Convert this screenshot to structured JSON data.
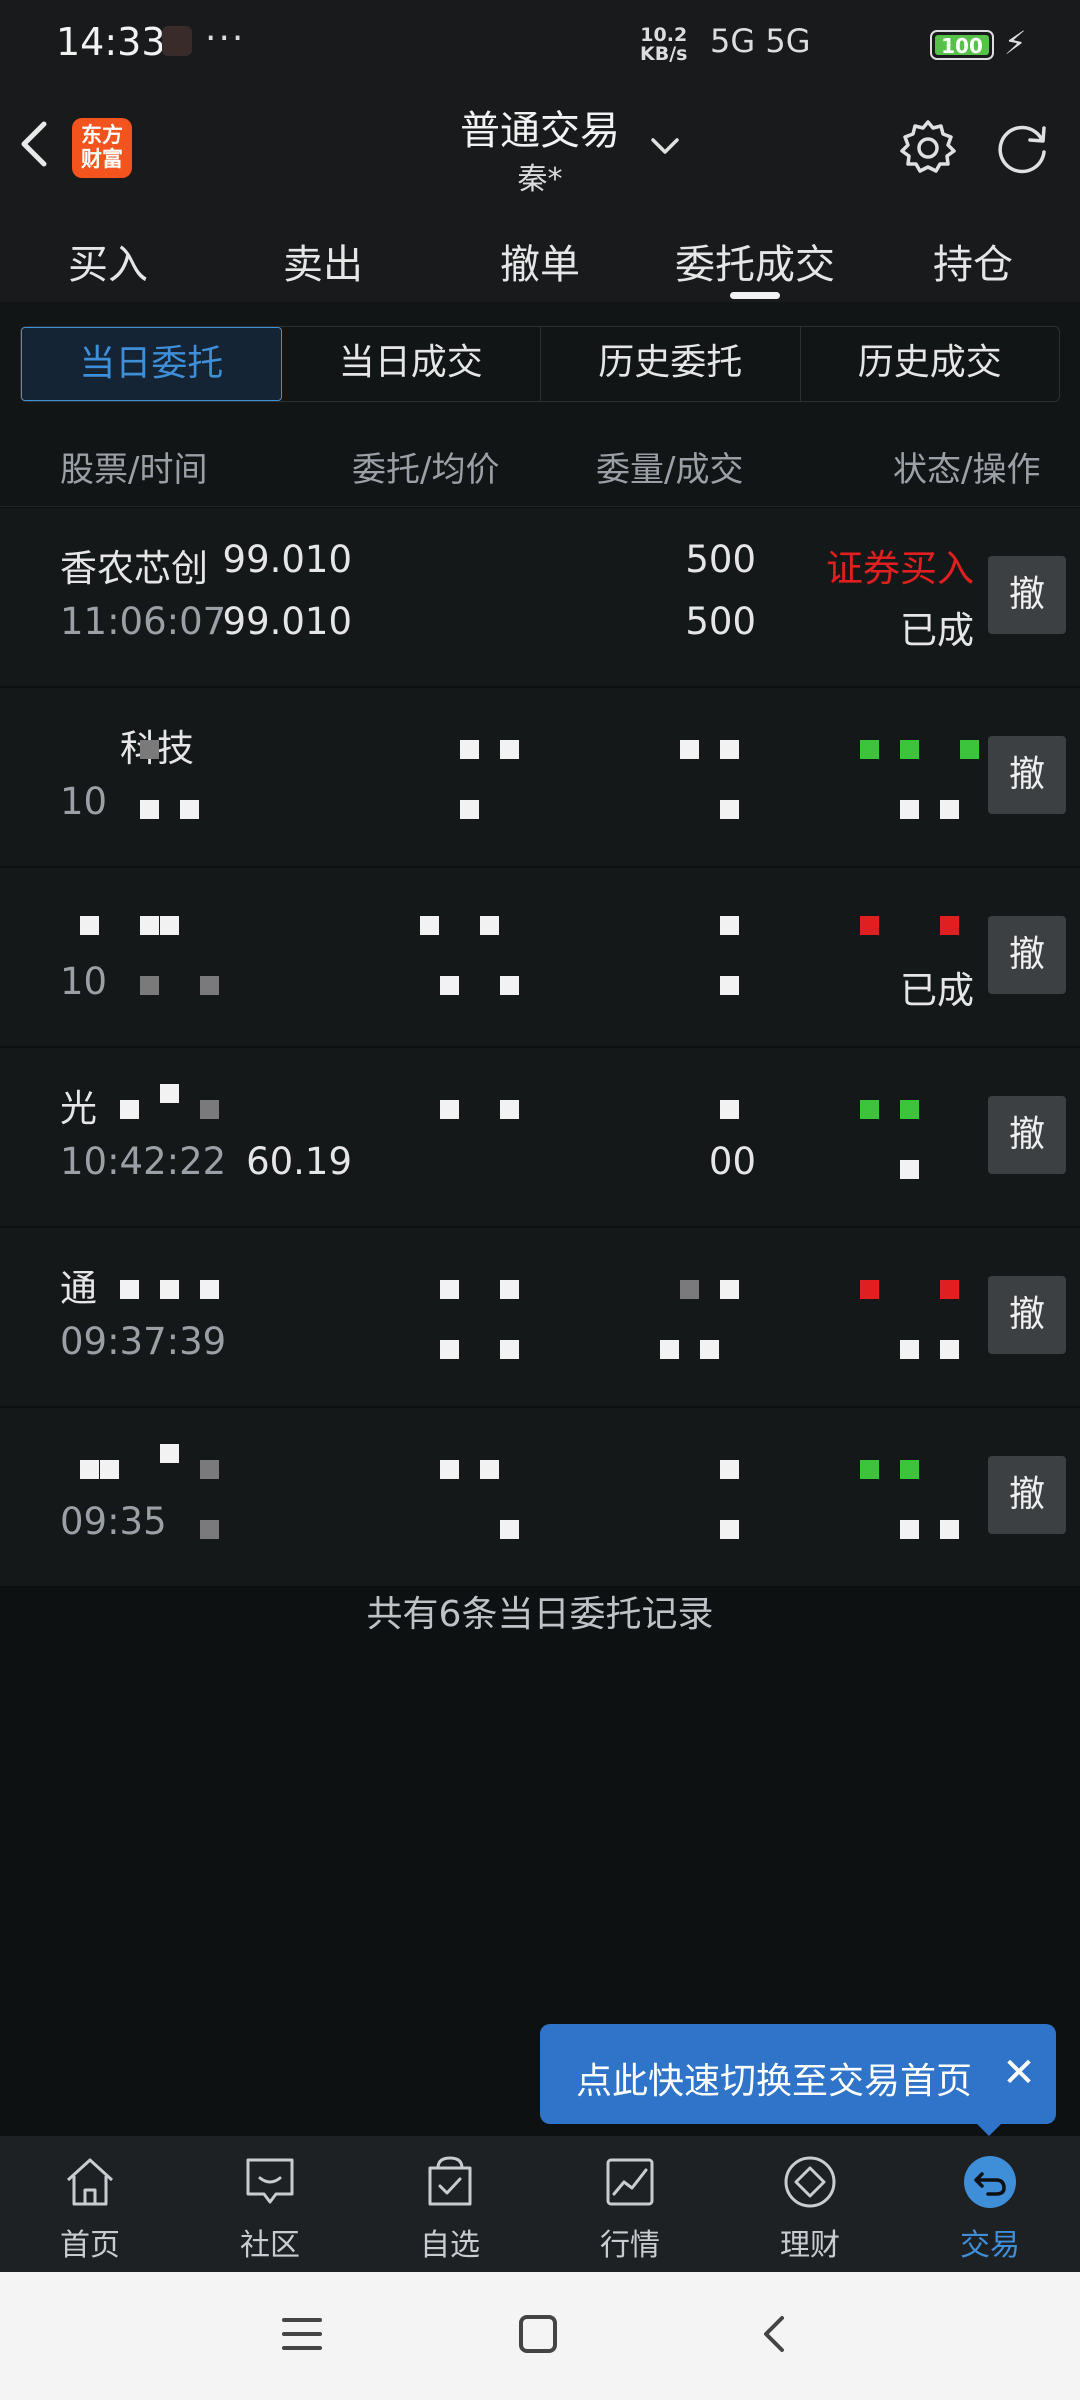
{
  "status_bar": {
    "time": "14:33",
    "dots": "···",
    "net_speed_top": "10.2",
    "net_speed_bottom": "KB/s",
    "signal_icons": "5G 5G",
    "battery": "100"
  },
  "header": {
    "logo_text": "东方财富",
    "title": "普通交易",
    "subtitle": "秦*"
  },
  "tabs": [
    "买入",
    "卖出",
    "撤单",
    "委托成交",
    "持仓"
  ],
  "active_tab": "委托成交",
  "segments": [
    "当日委托",
    "当日成交",
    "历史委托",
    "历史成交"
  ],
  "active_segment": "当日委托",
  "columns": {
    "stock_time": "股票/时间",
    "price_avg": "委托/均价",
    "qty_deal": "委量/成交",
    "status_op": "状态/操作"
  },
  "rows": [
    {
      "name": "香农芯创",
      "time": "11:06:07",
      "price": "99.010",
      "avg": "99.010",
      "qty": "500",
      "deal": "500",
      "status": "证券买入",
      "op": "已成",
      "cancel": "撤"
    },
    {
      "name": "科技",
      "time": "10",
      "price": "",
      "avg": "",
      "qty": "",
      "deal": "",
      "status": "",
      "op": "",
      "cancel": "撤"
    },
    {
      "name": "",
      "time": "10",
      "price": "",
      "avg": "",
      "qty": "",
      "deal": "",
      "status": "",
      "op": "已成",
      "cancel": "撤"
    },
    {
      "name": "光",
      "time": "10:42:22",
      "price": "",
      "avg": "60.19",
      "qty": "",
      "deal": "00",
      "status": "",
      "op": "",
      "cancel": "撤"
    },
    {
      "name": "通",
      "time": "09:37:39",
      "price": "",
      "avg": "",
      "qty": "",
      "deal": "",
      "status": "",
      "op": "",
      "cancel": "撤"
    },
    {
      "name": "",
      "time": "09:35",
      "price": "",
      "avg": "",
      "qty": "",
      "deal": "",
      "status": "",
      "op": "",
      "cancel": "撤"
    }
  ],
  "records_text": "共有6条当日委托记录",
  "tooltip": {
    "text": "点此快速切换至交易首页",
    "close": "✕"
  },
  "bottom_nav": [
    "首页",
    "社区",
    "自选",
    "行情",
    "理财",
    "交易"
  ],
  "active_nav": "交易",
  "colors": {
    "accent": "#3f8ed8",
    "buy_red": "#e02020",
    "background": "#0e1112",
    "tooltip_blue": "#2f74c9"
  }
}
